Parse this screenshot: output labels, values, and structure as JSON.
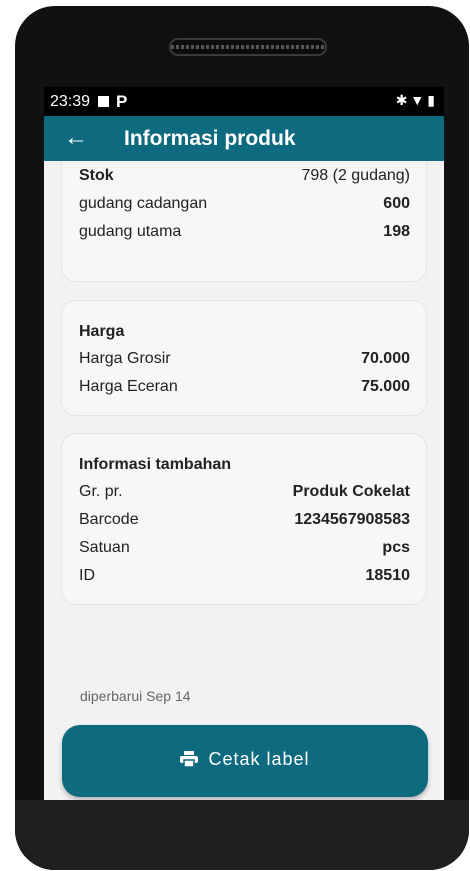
{
  "status_bar": {
    "time": "23:39",
    "app_icon": "P",
    "right_icons": [
      "bluetooth-icon",
      "wifi-icon",
      "battery-icon"
    ]
  },
  "app_bar": {
    "title": "Informasi produk",
    "back_icon": "arrow-left-icon"
  },
  "stock": {
    "label": "Stok",
    "value": "798 (2 gudang)",
    "rows": [
      {
        "label": "gudang cadangan",
        "value": "600"
      },
      {
        "label": "gudang utama",
        "value": "198"
      }
    ]
  },
  "price": {
    "title": "Harga",
    "rows": [
      {
        "label": "Harga Grosir",
        "value": "70.000"
      },
      {
        "label": "Harga Eceran",
        "value": "75.000"
      }
    ]
  },
  "extra": {
    "title": "Informasi tambahan",
    "rows": [
      {
        "label": "Gr. pr.",
        "value": "Produk Cokelat"
      },
      {
        "label": "Barcode",
        "value": "1234567908583"
      },
      {
        "label": "Satuan",
        "value": "pcs"
      },
      {
        "label": "ID",
        "value": "18510"
      }
    ]
  },
  "updated": "diperbarui Sep 14",
  "print_button": {
    "label": "Cetak label",
    "icon": "printer-icon"
  },
  "colors": {
    "primary": "#0e6a7e",
    "background": "#f2f2f2"
  }
}
